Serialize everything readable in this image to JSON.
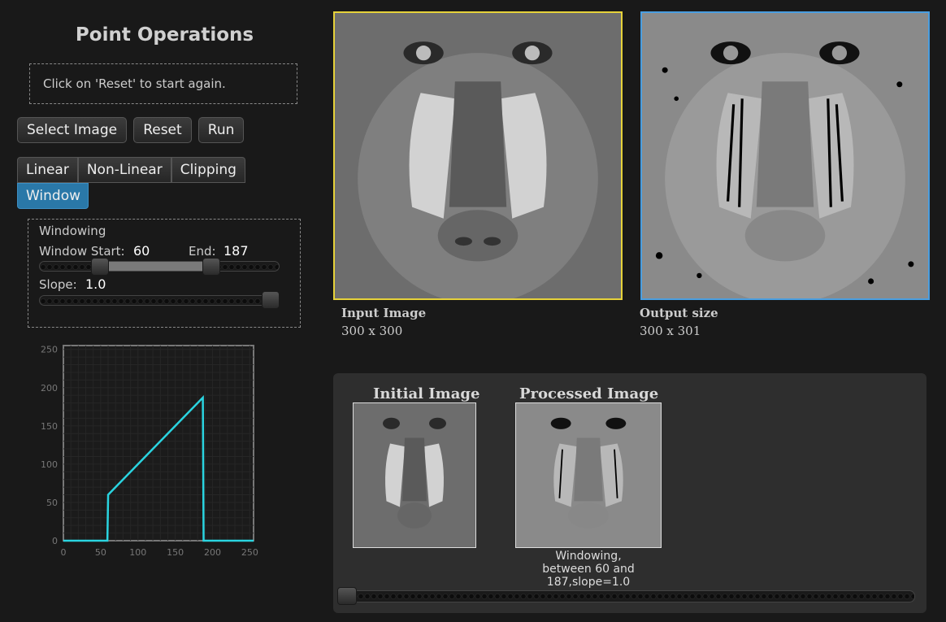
{
  "page_title": "Point Operations",
  "message": "Click on 'Reset' to start again.",
  "buttons": {
    "select_image": "Select Image",
    "reset": "Reset",
    "run": "Run"
  },
  "tabs": [
    {
      "label": "Linear",
      "active": false
    },
    {
      "label": "Non-Linear",
      "active": false
    },
    {
      "label": "Clipping",
      "active": false
    },
    {
      "label": "Window",
      "active": true
    }
  ],
  "windowing": {
    "heading": "Windowing",
    "start_label": "Window Start:",
    "start_value": "60",
    "end_label": "End:",
    "end_value": "187",
    "slope_label": "Slope:",
    "slope_value": "1.0",
    "range_min": 0,
    "range_max": 255,
    "slope_fraction": 1.0
  },
  "input_image": {
    "label": "Input Image",
    "size": "300 x 300"
  },
  "output_image": {
    "label": "Output size",
    "size": "300 x 301"
  },
  "history": {
    "initial_title": "Initial Image",
    "processed_title": "Processed Image",
    "processed_caption_lines": [
      "Windowing,",
      "between 60 and",
      "187,slope=1.0"
    ],
    "scroll_fraction": 0.0
  },
  "colors": {
    "input_border": "#e6d23a",
    "output_border": "#4a9ee0",
    "curve": "#2ad4e0",
    "active_tab": "#2a78a8"
  },
  "chart_data": {
    "type": "line",
    "title": "",
    "xlabel": "",
    "ylabel": "",
    "xlim": [
      0,
      255
    ],
    "ylim": [
      0,
      255
    ],
    "xticks": [
      0,
      50,
      100,
      150,
      200,
      250
    ],
    "yticks": [
      0,
      50,
      100,
      150,
      200,
      250
    ],
    "grid": true,
    "series": [
      {
        "x": [
          0,
          59,
          60,
          187,
          188,
          255
        ],
        "y": [
          0,
          0,
          60,
          187,
          0,
          0
        ]
      }
    ]
  }
}
